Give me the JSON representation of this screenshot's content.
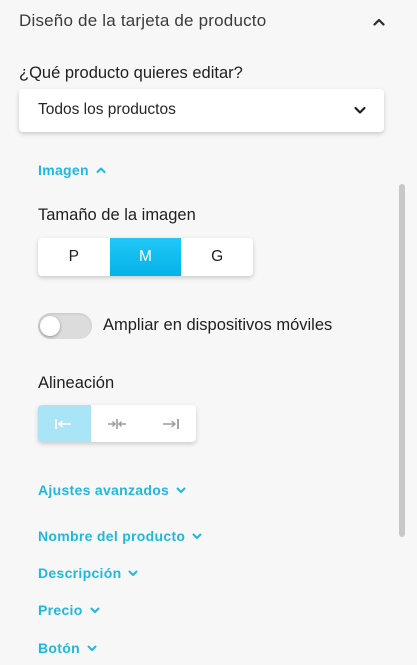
{
  "panel": {
    "title": "Diseño de la tarjeta de producto"
  },
  "product_select": {
    "question": "¿Qué producto quieres editar?",
    "value": "Todos los productos"
  },
  "image_section": {
    "label": "Imagen",
    "size_label": "Tamaño de la imagen",
    "sizes": [
      "P",
      "M",
      "G"
    ],
    "selected_size": "M",
    "mobile_zoom_label": "Ampliar en dispositivos móviles",
    "mobile_zoom_enabled": false,
    "alignment_label": "Alineación",
    "alignments": [
      "align-left-icon",
      "align-center-icon",
      "align-right-icon"
    ],
    "selected_alignment": "left"
  },
  "sections": {
    "advanced": "Ajustes avanzados",
    "product_name": "Nombre del producto",
    "description": "Descripción",
    "price": "Precio",
    "button": "Botón"
  },
  "colors": {
    "accent": "#20b7e0",
    "active_button": "#04b2e8",
    "active_align": "#a9e5f6"
  }
}
